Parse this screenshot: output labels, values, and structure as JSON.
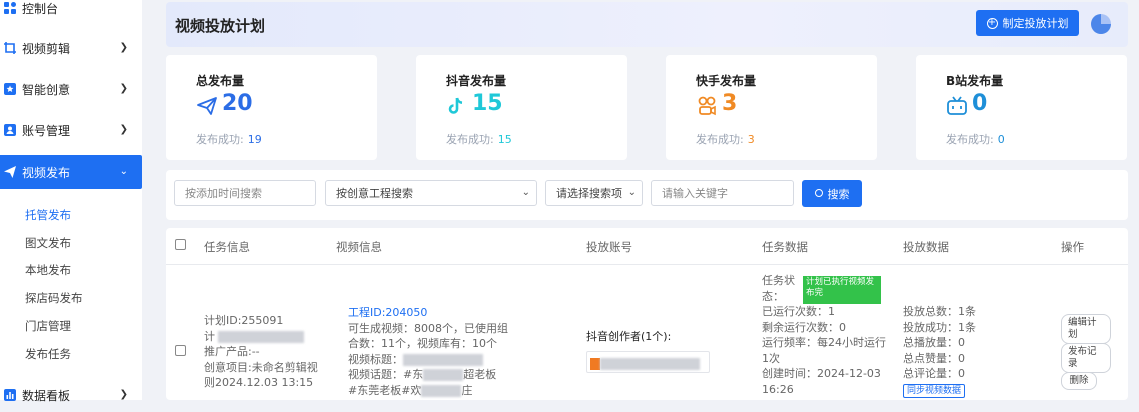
{
  "sidebar": {
    "items": [
      {
        "label": "控制台"
      },
      {
        "label": "视频剪辑"
      },
      {
        "label": "智能创意"
      },
      {
        "label": "账号管理"
      },
      {
        "label": "视频发布"
      },
      {
        "label": "数据看板"
      }
    ],
    "sub_items": [
      "托管发布",
      "图文发布",
      "本地发布",
      "探店码发布",
      "门店管理",
      "发布任务"
    ]
  },
  "header": {
    "title": "视频投放计划",
    "create_button": "制定投放计划"
  },
  "stats": [
    {
      "title": "总发布量",
      "value": "20",
      "sub_label": "发布成功:",
      "sub_value": "19",
      "color": "#2b6de6",
      "icon": "send-icon"
    },
    {
      "title": "抖音发布量",
      "value": "15",
      "sub_label": "发布成功:",
      "sub_value": "15",
      "color": "#1fc8d8",
      "icon": "douyin-icon"
    },
    {
      "title": "快手发布量",
      "value": "3",
      "sub_label": "发布成功:",
      "sub_value": "3",
      "color": "#f08a24",
      "icon": "kuaishou-icon"
    },
    {
      "title": "B站发布量",
      "value": "0",
      "sub_label": "发布成功:",
      "sub_value": "0",
      "color": "#1e8fd8",
      "icon": "bilibili-icon"
    }
  ],
  "filters": {
    "time_placeholder": "按添加时间搜索",
    "project_select": "按创意工程搜索",
    "search_type_select": "请选择搜索项",
    "keyword_placeholder": "请输入关键字",
    "search_button": "搜索"
  },
  "table": {
    "headers": [
      "任务信息",
      "视频信息",
      "投放账号",
      "任务数据",
      "投放数据",
      "操作"
    ],
    "row": {
      "task_info": {
        "plan_id": "计划ID:255091",
        "plan_prefix": "计",
        "product": "推广产品:--",
        "project": "创意项目:未命名剪辑视",
        "date": "则2024.12.03 13:15"
      },
      "video_info": {
        "project_id_label": "工程ID:",
        "project_id": "204050",
        "line1": "可生成视频：8008个，已使用组",
        "line2": "合数：11个，视频库有：10个",
        "title_label": "视频标题：",
        "topic_label": "视频话题：#东",
        "topic_tail": "超老板",
        "topic_line2a": "#东莞老板#欢",
        "topic_line2b": "庄"
      },
      "account": {
        "label": "抖音创作者(1个):"
      },
      "task_data": {
        "status_label": "任务状",
        "status_label2": "态：",
        "status_tag": "计划已执行视频发布完",
        "run_count": "已运行次数：1",
        "remain_count": "剩余运行次数：0",
        "frequency": "运行频率：每24小时运行",
        "frequency2": "1次",
        "created_label": "创建时间：2024-12-03",
        "created_time": "16:26"
      },
      "delivery_data": {
        "total": "投放总数：1条",
        "success": "投放成功：1条",
        "plays": "总播放量：0",
        "likes": "总点赞量：0",
        "comments": "总评论量：0",
        "sync_button": "同步视频数据"
      },
      "actions": [
        "编辑计划",
        "发布记录",
        "删除"
      ]
    }
  }
}
